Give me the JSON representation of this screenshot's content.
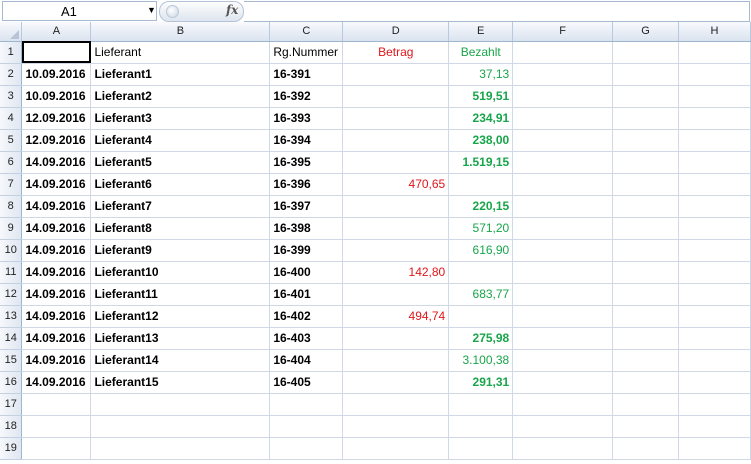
{
  "formula_bar": {
    "name_box": "A1",
    "fx_label": "fx",
    "formula": ""
  },
  "columns": [
    "A",
    "B",
    "C",
    "D",
    "E",
    "F",
    "G",
    "H"
  ],
  "row_numbers": [
    "1",
    "2",
    "3",
    "4",
    "5",
    "6",
    "7",
    "8",
    "9",
    "10",
    "11",
    "12",
    "13",
    "14",
    "15",
    "16",
    "17",
    "18",
    "19"
  ],
  "headers": {
    "b": "Lieferant",
    "c": "Rg.Nummer",
    "d": "Betrag",
    "e": "Bezahlt"
  },
  "rows": [
    {
      "date": "10.09.2016",
      "supplier": "Lieferant1",
      "invoice": "16-391",
      "amount": "",
      "paid": "37,13",
      "paid_bold": false
    },
    {
      "date": "10.09.2016",
      "supplier": "Lieferant2",
      "invoice": "16-392",
      "amount": "",
      "paid": "519,51",
      "paid_bold": true
    },
    {
      "date": "12.09.2016",
      "supplier": "Lieferant3",
      "invoice": "16-393",
      "amount": "",
      "paid": "234,91",
      "paid_bold": true
    },
    {
      "date": "12.09.2016",
      "supplier": "Lieferant4",
      "invoice": "16-394",
      "amount": "",
      "paid": "238,00",
      "paid_bold": true
    },
    {
      "date": "14.09.2016",
      "supplier": "Lieferant5",
      "invoice": "16-395",
      "amount": "",
      "paid": "1.519,15",
      "paid_bold": true
    },
    {
      "date": "14.09.2016",
      "supplier": "Lieferant6",
      "invoice": "16-396",
      "amount": "470,65",
      "paid": "",
      "paid_bold": false
    },
    {
      "date": "14.09.2016",
      "supplier": "Lieferant7",
      "invoice": "16-397",
      "amount": "",
      "paid": "220,15",
      "paid_bold": true
    },
    {
      "date": "14.09.2016",
      "supplier": "Lieferant8",
      "invoice": "16-398",
      "amount": "",
      "paid": "571,20",
      "paid_bold": false
    },
    {
      "date": "14.09.2016",
      "supplier": "Lieferant9",
      "invoice": "16-399",
      "amount": "",
      "paid": "616,90",
      "paid_bold": false
    },
    {
      "date": "14.09.2016",
      "supplier": "Lieferant10",
      "invoice": "16-400",
      "amount": "142,80",
      "paid": "",
      "paid_bold": false
    },
    {
      "date": "14.09.2016",
      "supplier": "Lieferant11",
      "invoice": "16-401",
      "amount": "",
      "paid": "683,77",
      "paid_bold": false
    },
    {
      "date": "14.09.2016",
      "supplier": "Lieferant12",
      "invoice": "16-402",
      "amount": "494,74",
      "paid": "",
      "paid_bold": false
    },
    {
      "date": "14.09.2016",
      "supplier": "Lieferant13",
      "invoice": "16-403",
      "amount": "",
      "paid": "275,98",
      "paid_bold": true
    },
    {
      "date": "14.09.2016",
      "supplier": "Lieferant14",
      "invoice": "16-404",
      "amount": "",
      "paid": "3.100,38",
      "paid_bold": false
    },
    {
      "date": "14.09.2016",
      "supplier": "Lieferant15",
      "invoice": "16-405",
      "amount": "",
      "paid": "291,31",
      "paid_bold": true
    }
  ],
  "colors": {
    "red_text": "#e0161b",
    "green_text": "#18a54a",
    "header_bg": "#dae3ef",
    "grid_line": "#d0d7e5"
  },
  "icons": {
    "dropdown": "chevron-down-icon",
    "fx": "function-icon"
  }
}
